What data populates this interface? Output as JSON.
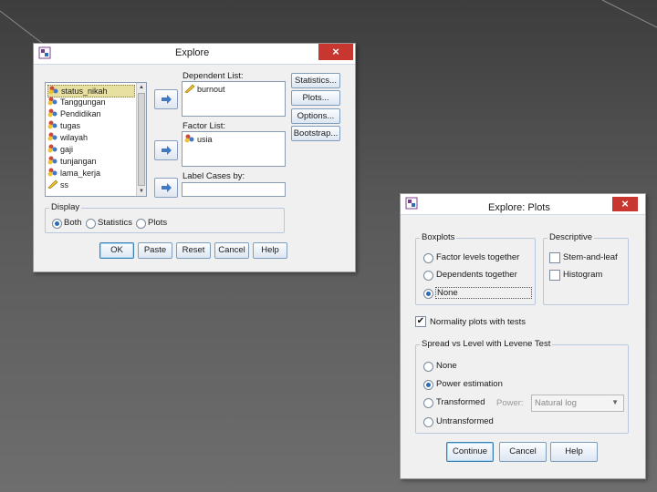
{
  "explore": {
    "title": "Explore",
    "close": "×",
    "dependent_list_label": "Dependent List:",
    "dependent_items": [
      "burnout"
    ],
    "factor_list_label": "Factor List:",
    "factor_items": [
      "usia"
    ],
    "label_cases_label": "Label Cases by:",
    "label_cases_value": "",
    "variables": [
      "status_nikah",
      "Tanggungan",
      "Pendidikan",
      "tugas",
      "wilayah",
      "gaji",
      "tunjangan",
      "lama_kerja",
      "ss"
    ],
    "side_buttons": {
      "statistics": "Statistics...",
      "plots": "Plots...",
      "options": "Options...",
      "bootstrap": "Bootstrap..."
    },
    "display": {
      "title": "Display",
      "both": "Both",
      "statistics": "Statistics",
      "plots": "Plots",
      "selected": "Both"
    },
    "footer": {
      "ok": "OK",
      "paste": "Paste",
      "reset": "Reset",
      "cancel": "Cancel",
      "help": "Help"
    }
  },
  "plots": {
    "title": "Explore: Plots",
    "close": "×",
    "boxplots": {
      "title": "Boxplots",
      "factor_levels": "Factor levels together",
      "dependents": "Dependents together",
      "none": "None",
      "selected": "None"
    },
    "descriptive": {
      "title": "Descriptive",
      "stem_leaf": "Stem-and-leaf",
      "stem_leaf_checked": false,
      "histogram": "Histogram",
      "histogram_checked": false
    },
    "normality": {
      "label": "Normality plots with tests",
      "checked": true
    },
    "spread": {
      "title": "Spread vs Level with Levene Test",
      "none": "None",
      "power_estimation": "Power estimation",
      "transformed": "Transformed",
      "untransformed": "Untransformed",
      "selected": "Power estimation",
      "power_label": "Power:",
      "power_value": "Natural log"
    },
    "footer": {
      "continue": "Continue",
      "cancel": "Cancel",
      "help": "Help"
    }
  },
  "colors": {
    "close_red": "#c7372f",
    "accent_blue": "#2b6cb4",
    "selection_yellow": "#e8e0a0"
  }
}
